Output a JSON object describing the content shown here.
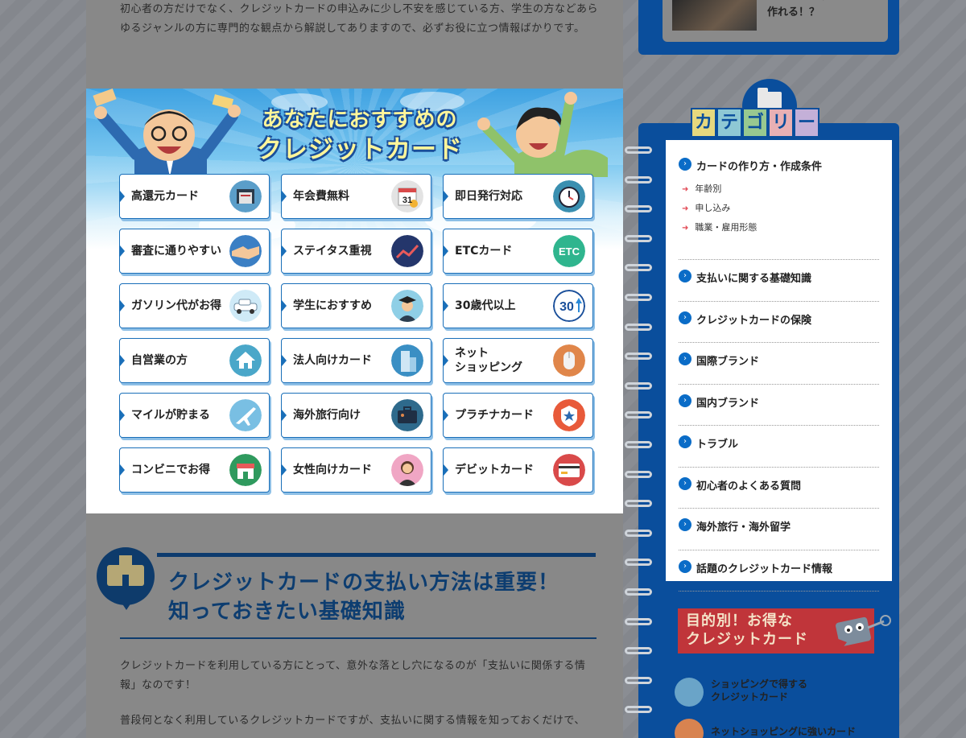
{
  "intro_text": "初心者の方だけでなく、クレジットカードの申込みに少し不安を感じている方、学生の方などあらゆるジャンルの方に専門的な観点から解説してありますので、必ずお役に立つ情報ばかりです。",
  "section": {
    "title_line1": "クレジットカードの支払い方法は重要！",
    "title_line2": "知っておきたい基礎知識"
  },
  "body_paragraphs": [
    "クレジットカードを利用している方にとって、意外な落とし穴になるのが「支払いに関係する情報」なのです！",
    "普段何となく利用しているクレジットカードですが、支払いに関する情報を知っておくだけで、"
  ],
  "modal": {
    "title_line1": "あなたにおすすめの",
    "title_line2": "クレジットカード",
    "cards": [
      {
        "label": "高還元カード",
        "icon": "card-slot-icon",
        "color": "#5b9ec9"
      },
      {
        "label": "年会費無料",
        "icon": "calendar-icon",
        "color": "#e3e3e3",
        "calendar_day": "31"
      },
      {
        "label": "即日発行対応",
        "icon": "stopwatch-icon",
        "color": "#3a8fb0"
      },
      {
        "label": "審査に通りやすい",
        "icon": "handshake-icon",
        "color": "#3b7fc4"
      },
      {
        "label": "ステイタス重視",
        "icon": "rising-graph-icon",
        "color": "#24366b"
      },
      {
        "label": "ETCカード",
        "icon": "etc-icon",
        "color": "#2fb58e",
        "icon_text": "ETC"
      },
      {
        "label": "ガソリン代がお得",
        "icon": "car-icon",
        "color": "#cfeaf7"
      },
      {
        "label": "学生におすすめ",
        "icon": "graduate-icon",
        "color": "#8fcfe6"
      },
      {
        "label": "30歳代以上",
        "icon": "age-30-up-icon",
        "color": "#ffffff",
        "icon_text": "30"
      },
      {
        "label": "自営業の方",
        "icon": "house-icon",
        "color": "#4aa7c9"
      },
      {
        "label": "法人向けカード",
        "icon": "office-building-icon",
        "color": "#3a8fc4"
      },
      {
        "label": "ネット\nショッピング",
        "icon": "mouse-icon",
        "color": "#e0864a"
      },
      {
        "label": "マイルが貯まる",
        "icon": "airplane-icon",
        "color": "#79bfe3"
      },
      {
        "label": "海外旅行向け",
        "icon": "suitcase-icon",
        "color": "#2e6a8c"
      },
      {
        "label": "プラチナカード",
        "icon": "badge-icon",
        "color": "#e85a3a"
      },
      {
        "label": "コンビニでお得",
        "icon": "store-icon",
        "color": "#2f9a5e"
      },
      {
        "label": "女性向けカード",
        "icon": "woman-icon",
        "color": "#f0a6c4"
      },
      {
        "label": "デビットカード",
        "icon": "debit-card-icon",
        "color": "#d94a4a"
      }
    ]
  },
  "sidebar": {
    "top_link_text": "でもクレジットカードは\n作れる！？",
    "category_heading": [
      "カ",
      "テ",
      "ゴ",
      "リ",
      "ー"
    ],
    "categories": [
      {
        "label": "カードの作り方・作成条件",
        "subs": [
          "年齢別",
          "申し込み",
          "職業・雇用形態"
        ]
      },
      {
        "label": "支払いに関する基礎知識"
      },
      {
        "label": "クレジットカードの保険"
      },
      {
        "label": "国際ブランド"
      },
      {
        "label": "国内ブランド"
      },
      {
        "label": "トラブル"
      },
      {
        "label": "初心者のよくある質問"
      },
      {
        "label": "海外旅行・海外留学"
      },
      {
        "label": "話題のクレジットカード情報"
      }
    ],
    "purpose_banner": {
      "line1": "目的別！お得な",
      "line2": "クレジットカード"
    },
    "purpose_items": [
      {
        "line1": "ショッピングで得する",
        "line2": "クレジットカード"
      },
      {
        "line1": "ネットショッピングに強いカード",
        "line2": ""
      }
    ]
  }
}
